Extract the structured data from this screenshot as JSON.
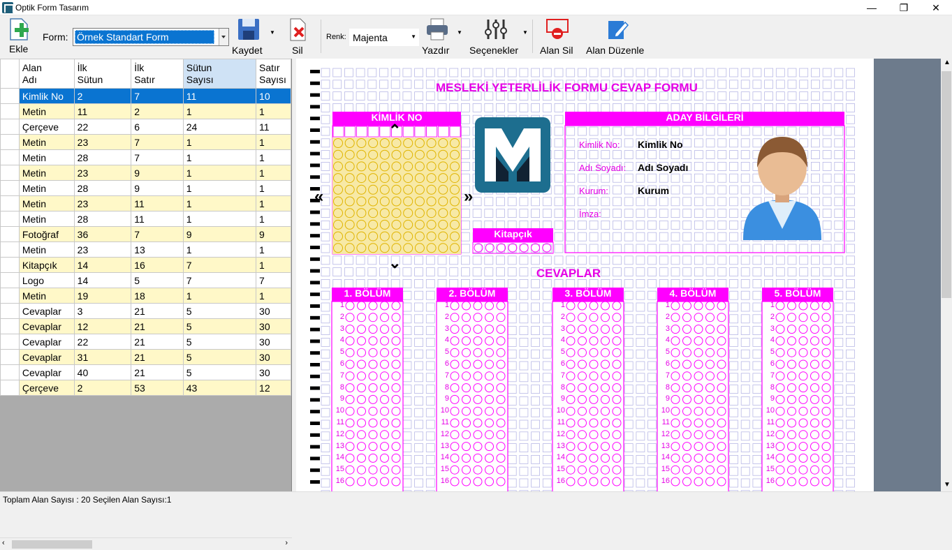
{
  "window": {
    "title": "Optik Form Tasarım",
    "minimize": "—",
    "maximize": "❐",
    "close": "✕"
  },
  "toolbar": {
    "add_label": "Ekle",
    "form_label": "Form:",
    "form_value": "Örnek Standart Form",
    "save_label": "Kaydet",
    "delete_label": "Sil",
    "color_label": "Renk:",
    "color_value": "Majenta",
    "print_label": "Yazdır",
    "options_label": "Seçenekler",
    "remove_area_label": "Alan Sil",
    "edit_area_label": "Alan Düzenle"
  },
  "grid": {
    "columns": [
      [
        "Alan",
        "Adı"
      ],
      [
        "İlk",
        "Sütun"
      ],
      [
        "İlk",
        "Satır"
      ],
      [
        "Sütun",
        "Sayısı"
      ],
      [
        "Satır",
        "Sayısı"
      ]
    ],
    "rows": [
      [
        "Kimlik No",
        "2",
        "7",
        "11",
        "10"
      ],
      [
        "Metin",
        "11",
        "2",
        "1",
        "1"
      ],
      [
        "Çerçeve",
        "22",
        "6",
        "24",
        "11"
      ],
      [
        "Metin",
        "23",
        "7",
        "1",
        "1"
      ],
      [
        "Metin",
        "28",
        "7",
        "1",
        "1"
      ],
      [
        "Metin",
        "23",
        "9",
        "1",
        "1"
      ],
      [
        "Metin",
        "28",
        "9",
        "1",
        "1"
      ],
      [
        "Metin",
        "23",
        "11",
        "1",
        "1"
      ],
      [
        "Metin",
        "28",
        "11",
        "1",
        "1"
      ],
      [
        "Fotoğraf",
        "36",
        "7",
        "9",
        "9"
      ],
      [
        "Metin",
        "23",
        "13",
        "1",
        "1"
      ],
      [
        "Kitapçık",
        "14",
        "16",
        "7",
        "1"
      ],
      [
        "Logo",
        "14",
        "5",
        "7",
        "7"
      ],
      [
        "Metin",
        "19",
        "18",
        "1",
        "1"
      ],
      [
        "Cevaplar",
        "3",
        "21",
        "5",
        "30"
      ],
      [
        "Cevaplar",
        "12",
        "21",
        "5",
        "30"
      ],
      [
        "Cevaplar",
        "22",
        "21",
        "5",
        "30"
      ],
      [
        "Cevaplar",
        "31",
        "21",
        "5",
        "30"
      ],
      [
        "Cevaplar",
        "40",
        "21",
        "5",
        "30"
      ],
      [
        "Çerçeve",
        "2",
        "53",
        "43",
        "12"
      ]
    ],
    "selected_index": 0
  },
  "form": {
    "title": "MESLEKİ YETERLİLİK FORMU CEVAP FORMU",
    "id_header": "KİMLİK NO",
    "candidate_header": "ADAY BİLGİLERİ",
    "fields": [
      {
        "label": "Kimlik No:",
        "value": "Kimlik No"
      },
      {
        "label": "Adı Soyadı:",
        "value": "Adı Soyadı"
      },
      {
        "label": "Kurum:",
        "value": "Kurum"
      },
      {
        "label": "İmza:",
        "value": ""
      }
    ],
    "booklet_header": "Kitapçık",
    "answers_header": "CEVAPLAR",
    "sections": [
      "1. BÖLÜM",
      "2. BÖLÜM",
      "3. BÖLÜM",
      "4. BÖLÜM",
      "5. BÖLÜM"
    ],
    "question_numbers": [
      "1",
      "2",
      "3",
      "4",
      "5",
      "6",
      "7",
      "8",
      "9",
      "10",
      "11",
      "12",
      "13",
      "14",
      "15",
      "16"
    ]
  },
  "status": {
    "text": "Toplam Alan Sayısı : 20 Seçilen Alan Sayısı:1"
  },
  "colors": {
    "accent": "#ff00ff",
    "selection": "#0a74d1",
    "row_alt": "#fff8c8",
    "panel": "#6d7b8c"
  }
}
